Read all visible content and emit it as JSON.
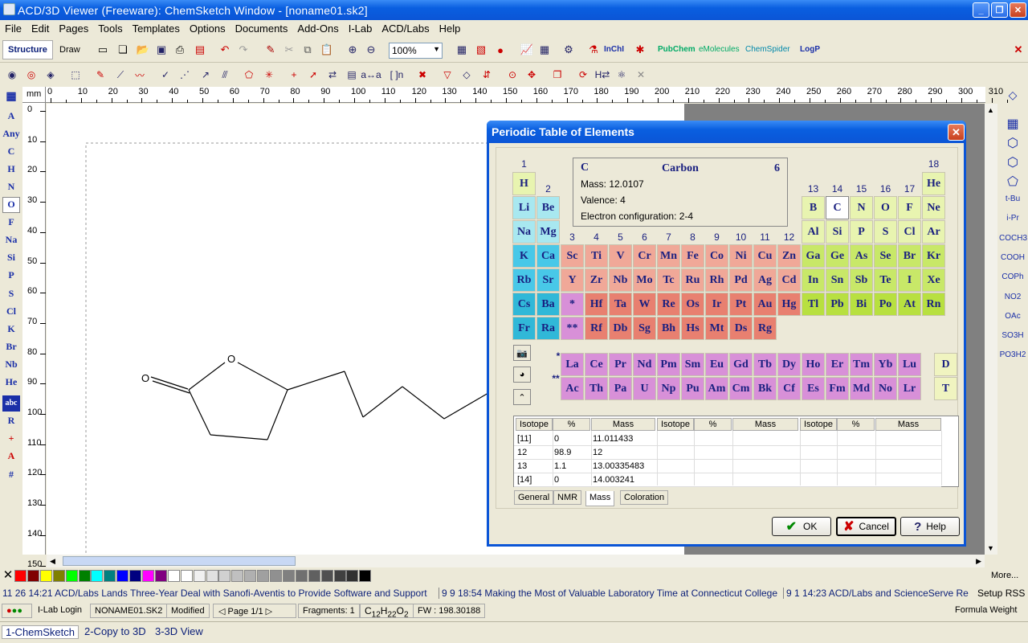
{
  "window": {
    "title": "ACD/3D Viewer (Freeware): ChemSketch Window - [noname01.sk2]"
  },
  "menu": [
    "File",
    "Edit",
    "Pages",
    "Tools",
    "Templates",
    "Options",
    "Documents",
    "Add-Ons",
    "I-Lab",
    "ACD/Labs",
    "Help"
  ],
  "toolbar": {
    "structure_label": "Structure",
    "draw_label": "Draw",
    "zoom_value": "100%",
    "inchi_label": "InChI",
    "pubchem_label": "PubChem",
    "emolecules_label": "eMolecules",
    "chemspider_label": "ChemSpider",
    "logp_label": "LogP"
  },
  "left_tools": [
    "A",
    "Any",
    "C",
    "H",
    "N",
    "O",
    "F",
    "Na",
    "Si",
    "P",
    "S",
    "Cl",
    "K",
    "Br",
    "Nb",
    "He",
    "abc",
    "R",
    "+",
    "A",
    "#"
  ],
  "right_tools": [
    "t-Bu",
    "i-Pr",
    "COCH3",
    "COOH",
    "COPh",
    "NO2",
    "OAc",
    "SO3H",
    "PO3H2"
  ],
  "ruler": {
    "unit": "mm",
    "h_ticks": [
      "0",
      "10",
      "20",
      "30",
      "40",
      "50",
      "60",
      "70",
      "80",
      "90",
      "100",
      "110",
      "120",
      "130",
      "140",
      "150",
      "160",
      "170",
      "180",
      "190",
      "200",
      "210",
      "220",
      "230",
      "240",
      "250",
      "260",
      "270",
      "280",
      "290",
      "300",
      "310"
    ],
    "v_ticks": [
      "0",
      "10",
      "20",
      "30",
      "40",
      "50",
      "60",
      "70",
      "80",
      "90",
      "100",
      "110",
      "120",
      "130",
      "140",
      "150"
    ]
  },
  "molecule": {
    "atom_labels": [
      "O",
      "O"
    ]
  },
  "palette": {
    "colors": [
      "#ff0000",
      "#800000",
      "#ffff00",
      "#808000",
      "#00ff00",
      "#008000",
      "#00ffff",
      "#008080",
      "#0000ff",
      "#000080",
      "#ff00ff",
      "#800080",
      "#ffffff",
      "#ffffff",
      "#f0f0f0",
      "#e0e0e0",
      "#d0d0d0",
      "#c0c0c0",
      "#b0b0b0",
      "#a0a0a0",
      "#909090",
      "#808080",
      "#707070",
      "#606060",
      "#505050",
      "#404040",
      "#303030",
      "#000000"
    ],
    "more_label": "More..."
  },
  "news": {
    "items": [
      "11 26 14:21 ACD/Labs Lands Three-Year Deal with Sanofi-Aventis to Provide Software and Support",
      "9 9 18:54 Making the Most of Valuable Laboratory Time at Connecticut College",
      "9 1 14:23 ACD/Labs and ScienceServe Re"
    ],
    "setup_label": "Setup RSS"
  },
  "status": {
    "ilab": "I-Lab Login",
    "doc": "NONAME01.SK2",
    "modified": "Modified",
    "page": "Page 1/1",
    "fragments": "Fragments: 1",
    "formula_c": "C",
    "formula_c_n": "12",
    "formula_h": "H",
    "formula_h_n": "22",
    "formula_o": "O",
    "formula_o_n": "2",
    "fw": "FW : 198.30188",
    "right": "Formula Weight"
  },
  "bottom_tabs": [
    "1-ChemSketch",
    "2-Copy to 3D",
    "3-3D View"
  ],
  "dialog": {
    "title": "Periodic Table of Elements",
    "selected": {
      "symbol": "C",
      "name": "Carbon",
      "number": "6",
      "mass": "Mass: 12.0107",
      "valence": "Valence: 4",
      "config": "Electron configuration: 2-4"
    },
    "group_labels": [
      "1",
      "2",
      "3",
      "4",
      "5",
      "6",
      "7",
      "8",
      "9",
      "10",
      "11",
      "12",
      "13",
      "14",
      "15",
      "16",
      "17",
      "18"
    ],
    "series_marks": [
      "*",
      "**"
    ],
    "elements": [
      {
        "s": "H",
        "r": 0,
        "c": 0,
        "k": "nm"
      },
      {
        "s": "He",
        "r": 0,
        "c": 17,
        "k": "ng"
      },
      {
        "s": "Li",
        "r": 1,
        "c": 0,
        "k": "al"
      },
      {
        "s": "Be",
        "r": 1,
        "c": 1,
        "k": "al"
      },
      {
        "s": "B",
        "r": 1,
        "c": 12,
        "k": "nm"
      },
      {
        "s": "C",
        "r": 1,
        "c": 13,
        "k": "sel"
      },
      {
        "s": "N",
        "r": 1,
        "c": 14,
        "k": "nm"
      },
      {
        "s": "O",
        "r": 1,
        "c": 15,
        "k": "nm"
      },
      {
        "s": "F",
        "r": 1,
        "c": 16,
        "k": "nm"
      },
      {
        "s": "Ne",
        "r": 1,
        "c": 17,
        "k": "ng"
      },
      {
        "s": "Na",
        "r": 2,
        "c": 0,
        "k": "al"
      },
      {
        "s": "Mg",
        "r": 2,
        "c": 1,
        "k": "al"
      },
      {
        "s": "Al",
        "r": 2,
        "c": 12,
        "k": "nm"
      },
      {
        "s": "Si",
        "r": 2,
        "c": 13,
        "k": "nm"
      },
      {
        "s": "P",
        "r": 2,
        "c": 14,
        "k": "nm"
      },
      {
        "s": "S",
        "r": 2,
        "c": 15,
        "k": "nm"
      },
      {
        "s": "Cl",
        "r": 2,
        "c": 16,
        "k": "nm"
      },
      {
        "s": "Ar",
        "r": 2,
        "c": 17,
        "k": "ng"
      },
      {
        "s": "K",
        "r": 3,
        "c": 0,
        "k": "ak"
      },
      {
        "s": "Ca",
        "r": 3,
        "c": 1,
        "k": "ak"
      },
      {
        "s": "Sc",
        "r": 3,
        "c": 2,
        "k": "tl"
      },
      {
        "s": "Ti",
        "r": 3,
        "c": 3,
        "k": "tl"
      },
      {
        "s": "V",
        "r": 3,
        "c": 4,
        "k": "tl"
      },
      {
        "s": "Cr",
        "r": 3,
        "c": 5,
        "k": "tl"
      },
      {
        "s": "Mn",
        "r": 3,
        "c": 6,
        "k": "tl"
      },
      {
        "s": "Fe",
        "r": 3,
        "c": 7,
        "k": "tl"
      },
      {
        "s": "Co",
        "r": 3,
        "c": 8,
        "k": "tl"
      },
      {
        "s": "Ni",
        "r": 3,
        "c": 9,
        "k": "tl"
      },
      {
        "s": "Cu",
        "r": 3,
        "c": 10,
        "k": "tl"
      },
      {
        "s": "Zn",
        "r": 3,
        "c": 11,
        "k": "tl"
      },
      {
        "s": "Ga",
        "r": 3,
        "c": 12,
        "k": "pt"
      },
      {
        "s": "Ge",
        "r": 3,
        "c": 13,
        "k": "pt"
      },
      {
        "s": "As",
        "r": 3,
        "c": 14,
        "k": "pt"
      },
      {
        "s": "Se",
        "r": 3,
        "c": 15,
        "k": "pt"
      },
      {
        "s": "Br",
        "r": 3,
        "c": 16,
        "k": "pt"
      },
      {
        "s": "Kr",
        "r": 3,
        "c": 17,
        "k": "pt"
      },
      {
        "s": "Rb",
        "r": 4,
        "c": 0,
        "k": "ak"
      },
      {
        "s": "Sr",
        "r": 4,
        "c": 1,
        "k": "ak"
      },
      {
        "s": "Y",
        "r": 4,
        "c": 2,
        "k": "tl"
      },
      {
        "s": "Zr",
        "r": 4,
        "c": 3,
        "k": "tl"
      },
      {
        "s": "Nb",
        "r": 4,
        "c": 4,
        "k": "tl"
      },
      {
        "s": "Mo",
        "r": 4,
        "c": 5,
        "k": "tl"
      },
      {
        "s": "Tc",
        "r": 4,
        "c": 6,
        "k": "tl"
      },
      {
        "s": "Ru",
        "r": 4,
        "c": 7,
        "k": "tl"
      },
      {
        "s": "Rh",
        "r": 4,
        "c": 8,
        "k": "tl"
      },
      {
        "s": "Pd",
        "r": 4,
        "c": 9,
        "k": "tl"
      },
      {
        "s": "Ag",
        "r": 4,
        "c": 10,
        "k": "tl"
      },
      {
        "s": "Cd",
        "r": 4,
        "c": 11,
        "k": "tl"
      },
      {
        "s": "In",
        "r": 4,
        "c": 12,
        "k": "pt"
      },
      {
        "s": "Sn",
        "r": 4,
        "c": 13,
        "k": "pt"
      },
      {
        "s": "Sb",
        "r": 4,
        "c": 14,
        "k": "pt"
      },
      {
        "s": "Te",
        "r": 4,
        "c": 15,
        "k": "pt"
      },
      {
        "s": "I",
        "r": 4,
        "c": 16,
        "k": "pt"
      },
      {
        "s": "Xe",
        "r": 4,
        "c": 17,
        "k": "pt"
      },
      {
        "s": "Cs",
        "r": 5,
        "c": 0,
        "k": "ak2"
      },
      {
        "s": "Ba",
        "r": 5,
        "c": 1,
        "k": "ak2"
      },
      {
        "s": "*",
        "r": 5,
        "c": 2,
        "k": "ln"
      },
      {
        "s": "Hf",
        "r": 5,
        "c": 3,
        "k": "td"
      },
      {
        "s": "Ta",
        "r": 5,
        "c": 4,
        "k": "td"
      },
      {
        "s": "W",
        "r": 5,
        "c": 5,
        "k": "td"
      },
      {
        "s": "Re",
        "r": 5,
        "c": 6,
        "k": "td"
      },
      {
        "s": "Os",
        "r": 5,
        "c": 7,
        "k": "td"
      },
      {
        "s": "Ir",
        "r": 5,
        "c": 8,
        "k": "td"
      },
      {
        "s": "Pt",
        "r": 5,
        "c": 9,
        "k": "td"
      },
      {
        "s": "Au",
        "r": 5,
        "c": 10,
        "k": "td"
      },
      {
        "s": "Hg",
        "r": 5,
        "c": 11,
        "k": "td"
      },
      {
        "s": "Tl",
        "r": 5,
        "c": 12,
        "k": "pt2"
      },
      {
        "s": "Pb",
        "r": 5,
        "c": 13,
        "k": "pt2"
      },
      {
        "s": "Bi",
        "r": 5,
        "c": 14,
        "k": "pt2"
      },
      {
        "s": "Po",
        "r": 5,
        "c": 15,
        "k": "pt2"
      },
      {
        "s": "At",
        "r": 5,
        "c": 16,
        "k": "pt2"
      },
      {
        "s": "Rn",
        "r": 5,
        "c": 17,
        "k": "pt2"
      },
      {
        "s": "Fr",
        "r": 6,
        "c": 0,
        "k": "ak2"
      },
      {
        "s": "Ra",
        "r": 6,
        "c": 1,
        "k": "ak2"
      },
      {
        "s": "**",
        "r": 6,
        "c": 2,
        "k": "ln"
      },
      {
        "s": "Rf",
        "r": 6,
        "c": 3,
        "k": "td"
      },
      {
        "s": "Db",
        "r": 6,
        "c": 4,
        "k": "td"
      },
      {
        "s": "Sg",
        "r": 6,
        "c": 5,
        "k": "td"
      },
      {
        "s": "Bh",
        "r": 6,
        "c": 6,
        "k": "td"
      },
      {
        "s": "Hs",
        "r": 6,
        "c": 7,
        "k": "td"
      },
      {
        "s": "Mt",
        "r": 6,
        "c": 8,
        "k": "td"
      },
      {
        "s": "Ds",
        "r": 6,
        "c": 9,
        "k": "td"
      },
      {
        "s": "Rg",
        "r": 6,
        "c": 10,
        "k": "td"
      }
    ],
    "lanthanides": [
      "La",
      "Ce",
      "Pr",
      "Nd",
      "Pm",
      "Sm",
      "Eu",
      "Gd",
      "Tb",
      "Dy",
      "Ho",
      "Er",
      "Tm",
      "Yb",
      "Lu"
    ],
    "actinides": [
      "Ac",
      "Th",
      "Pa",
      "U",
      "Np",
      "Pu",
      "Am",
      "Cm",
      "Bk",
      "Cf",
      "Es",
      "Fm",
      "Md",
      "No",
      "Lr"
    ],
    "extra": [
      "D",
      "T"
    ],
    "isotope_headers": [
      "Isotope",
      "%",
      "Mass",
      "Isotope",
      "%",
      "Mass",
      "Isotope",
      "%",
      "Mass"
    ],
    "isotopes": [
      [
        "[11]",
        "0",
        "11.011433"
      ],
      [
        "12",
        "98.9",
        "12"
      ],
      [
        "13",
        "1.1",
        "13.00335483"
      ],
      [
        "[14]",
        "0",
        "14.003241"
      ]
    ],
    "tabs": [
      "General",
      "NMR",
      "Mass",
      "Coloration"
    ],
    "buttons": {
      "ok": "OK",
      "cancel": "Cancel",
      "help": "Help"
    }
  },
  "colors": {
    "nm": "#e8f4b0",
    "ng": "#e8f4b0",
    "al": "#a8e8f0",
    "ak": "#48c8e8",
    "ak2": "#30b8d8",
    "tl": "#f0a898",
    "td": "#e88070",
    "ln": "#d890d8",
    "pt": "#c8e868",
    "pt2": "#b8e040",
    "sel": "#ffffff"
  }
}
